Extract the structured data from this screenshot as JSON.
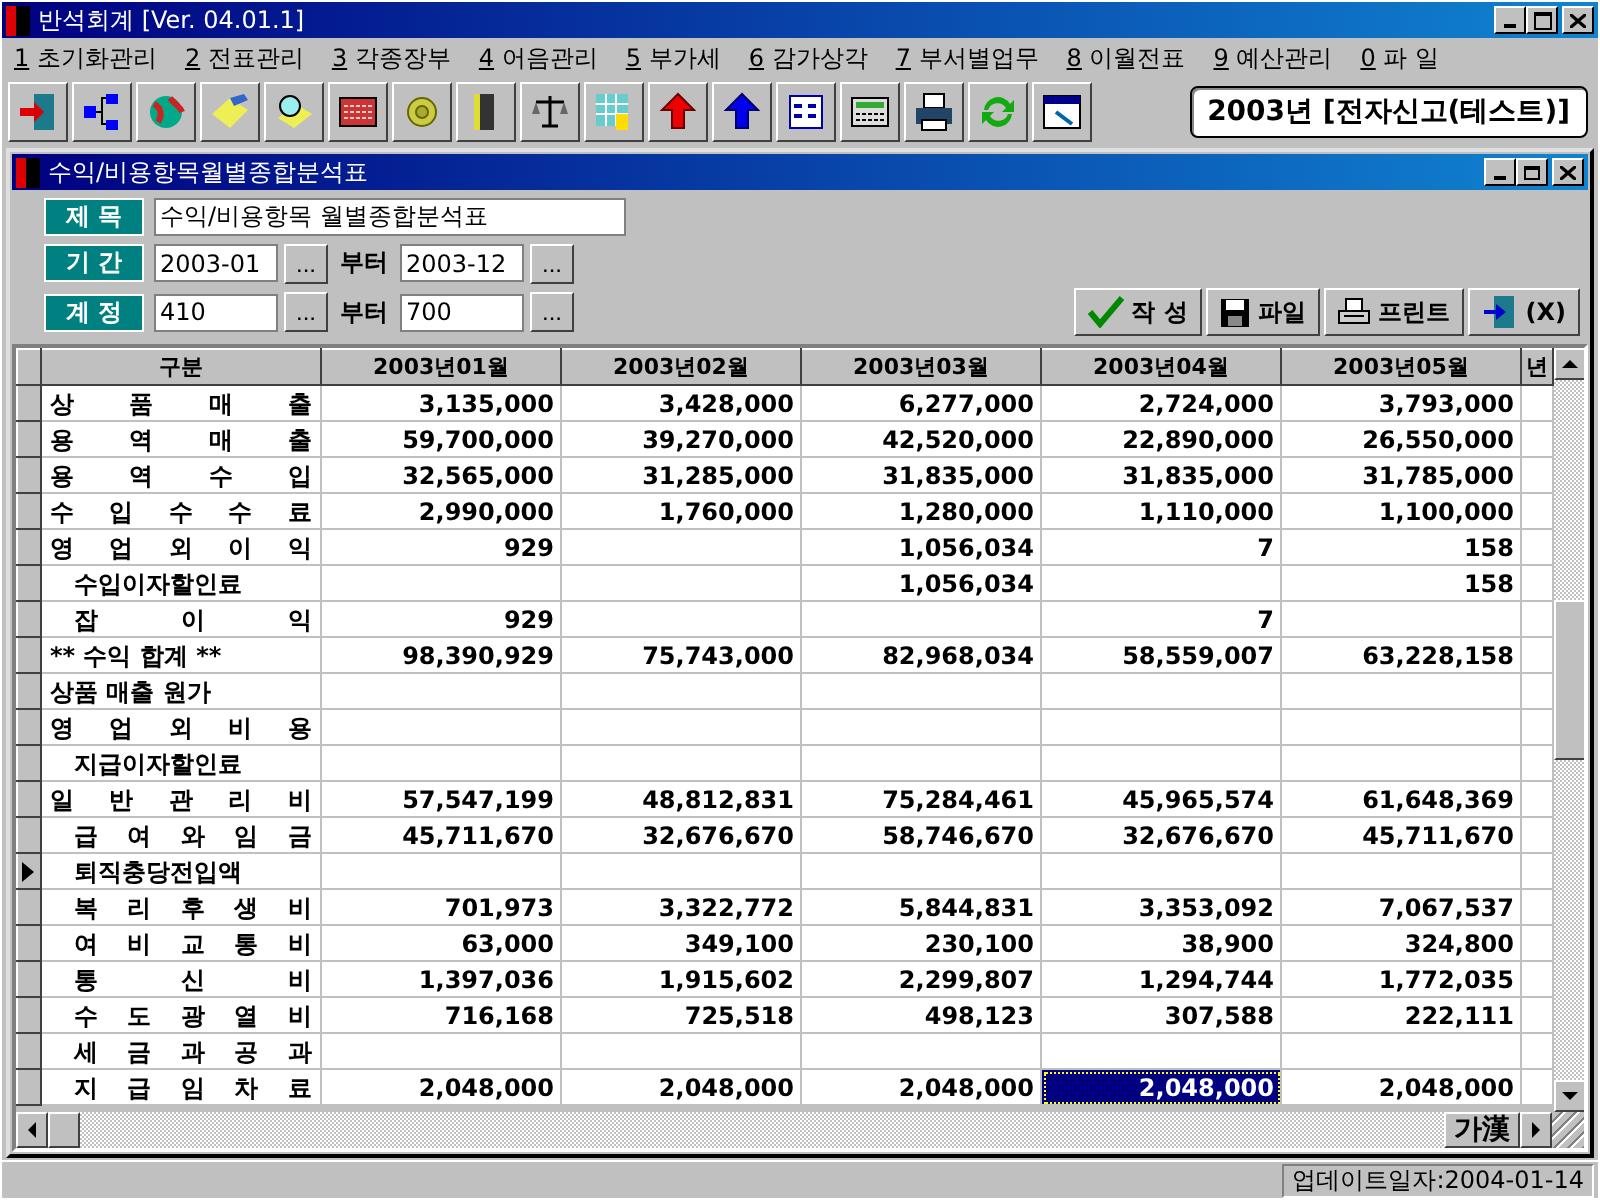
{
  "window": {
    "title": "반석회계 [Ver. 04.01.1]"
  },
  "menu": [
    {
      "key": "1",
      "label": "초기화관리"
    },
    {
      "key": "2",
      "label": "전표관리"
    },
    {
      "key": "3",
      "label": "각종장부"
    },
    {
      "key": "4",
      "label": "어음관리"
    },
    {
      "key": "5",
      "label": "부가세"
    },
    {
      "key": "6",
      "label": "감가상각"
    },
    {
      "key": "7",
      "label": "부서별업무"
    },
    {
      "key": "8",
      "label": "이월전표"
    },
    {
      "key": "9",
      "label": "예산관리"
    },
    {
      "key": "0",
      "label": "파 일"
    }
  ],
  "company_badge": "2003년 [전자신고(테스트)]",
  "child_window": {
    "title": "수익/비용항목월별종합분석표"
  },
  "form": {
    "title_label": "제 목",
    "title_value": "수익/비용항목 월별종합분석표",
    "period_label": "기 간",
    "period_from": "2003-01",
    "period_to": "2003-12",
    "account_label": "계 정",
    "account_from": "410",
    "account_to": "700",
    "from_word": [
      "부터",
      "부터"
    ],
    "browse": [
      "...",
      "...",
      "...",
      "..."
    ]
  },
  "actions": [
    {
      "kind": "check",
      "label": "작 성"
    },
    {
      "kind": "disk",
      "label": "파일"
    },
    {
      "kind": "printer",
      "label": "프린트"
    },
    {
      "kind": "exit",
      "label": "(X)"
    }
  ],
  "table": {
    "label_header": "구분",
    "columns": [
      "2003년01월",
      "2003년02월",
      "2003년03월",
      "2003년04월",
      "2003년05월",
      "년"
    ],
    "rows": [
      {
        "label": "상 품 매 출",
        "kind": "main",
        "current": false,
        "cells": [
          {
            "v": "3,135,000",
            "selected": false
          },
          {
            "v": "3,428,000",
            "selected": false
          },
          {
            "v": "6,277,000",
            "selected": false
          },
          {
            "v": "2,724,000",
            "selected": false
          },
          {
            "v": "3,793,000",
            "selected": false
          }
        ]
      },
      {
        "label": "용 역 매 출",
        "kind": "main",
        "current": false,
        "cells": [
          {
            "v": "59,700,000",
            "selected": false
          },
          {
            "v": "39,270,000",
            "selected": false
          },
          {
            "v": "42,520,000",
            "selected": false
          },
          {
            "v": "22,890,000",
            "selected": false
          },
          {
            "v": "26,550,000",
            "selected": false
          }
        ]
      },
      {
        "label": "용 역 수 입",
        "kind": "main",
        "current": false,
        "cells": [
          {
            "v": "32,565,000",
            "selected": false
          },
          {
            "v": "31,285,000",
            "selected": false
          },
          {
            "v": "31,835,000",
            "selected": false
          },
          {
            "v": "31,835,000",
            "selected": false
          },
          {
            "v": "31,785,000",
            "selected": false
          }
        ]
      },
      {
        "label": "수 입 수 수 료",
        "kind": "main",
        "current": false,
        "cells": [
          {
            "v": "2,990,000",
            "selected": false
          },
          {
            "v": "1,760,000",
            "selected": false
          },
          {
            "v": "1,280,000",
            "selected": false
          },
          {
            "v": "1,110,000",
            "selected": false
          },
          {
            "v": "1,100,000",
            "selected": false
          }
        ]
      },
      {
        "label": "영 업 외 이 익",
        "kind": "main",
        "current": false,
        "cells": [
          {
            "v": "929",
            "selected": false
          },
          {
            "selected": false
          },
          {
            "v": "1,056,034",
            "selected": false
          },
          {
            "v": "7",
            "selected": false
          },
          {
            "v": "158",
            "selected": false
          }
        ]
      },
      {
        "label": "수입이자할인료",
        "kind": "sub-plain",
        "current": false,
        "cells": [
          {
            "selected": false
          },
          {
            "selected": false
          },
          {
            "v": "1,056,034",
            "selected": false
          },
          {
            "selected": false
          },
          {
            "v": "158",
            "selected": false
          }
        ]
      },
      {
        "label": "잡 이 익",
        "kind": "sub",
        "current": false,
        "cells": [
          {
            "v": "929",
            "selected": false
          },
          {
            "selected": false
          },
          {
            "selected": false
          },
          {
            "v": "7",
            "selected": false
          },
          {
            "selected": false
          }
        ]
      },
      {
        "label": "** 수익 합계 **",
        "kind": "plain",
        "current": false,
        "cells": [
          {
            "v": "98,390,929",
            "selected": false
          },
          {
            "v": "75,743,000",
            "selected": false
          },
          {
            "v": "82,968,034",
            "selected": false
          },
          {
            "v": "58,559,007",
            "selected": false
          },
          {
            "v": "63,228,158",
            "selected": false
          }
        ]
      },
      {
        "label": "상품 매출 원가",
        "kind": "plain",
        "current": false,
        "cells": [
          {
            "selected": false
          },
          {
            "selected": false
          },
          {
            "selected": false
          },
          {
            "selected": false
          },
          {
            "selected": false
          }
        ]
      },
      {
        "label": "영 업 외 비 용",
        "kind": "main",
        "current": false,
        "cells": [
          {
            "selected": false
          },
          {
            "selected": false
          },
          {
            "selected": false
          },
          {
            "selected": false
          },
          {
            "selected": false
          }
        ]
      },
      {
        "label": "지급이자할인료",
        "kind": "sub-plain",
        "current": false,
        "cells": [
          {
            "selected": false
          },
          {
            "selected": false
          },
          {
            "selected": false
          },
          {
            "selected": false
          },
          {
            "selected": false
          }
        ]
      },
      {
        "label": "일 반 관 리 비",
        "kind": "main",
        "current": false,
        "cells": [
          {
            "v": "57,547,199",
            "selected": false
          },
          {
            "v": "48,812,831",
            "selected": false
          },
          {
            "v": "75,284,461",
            "selected": false
          },
          {
            "v": "45,965,574",
            "selected": false
          },
          {
            "v": "61,648,369",
            "selected": false
          }
        ]
      },
      {
        "label": "급 여 와 임 금",
        "kind": "sub",
        "current": false,
        "cells": [
          {
            "v": "45,711,670",
            "selected": false
          },
          {
            "v": "32,676,670",
            "selected": false
          },
          {
            "v": "58,746,670",
            "selected": false
          },
          {
            "v": "32,676,670",
            "selected": false
          },
          {
            "v": "45,711,670",
            "selected": false
          }
        ]
      },
      {
        "label": "퇴직충당전입액",
        "kind": "sub-plain",
        "current": true,
        "cells": [
          {
            "selected": false
          },
          {
            "selected": false
          },
          {
            "selected": false
          },
          {
            "selected": false
          },
          {
            "selected": false
          }
        ]
      },
      {
        "label": "복 리 후 생 비",
        "kind": "sub",
        "current": false,
        "cells": [
          {
            "v": "701,973",
            "selected": false
          },
          {
            "v": "3,322,772",
            "selected": false
          },
          {
            "v": "5,844,831",
            "selected": false
          },
          {
            "v": "3,353,092",
            "selected": false
          },
          {
            "v": "7,067,537",
            "selected": false
          }
        ]
      },
      {
        "label": "여 비 교 통 비",
        "kind": "sub",
        "current": false,
        "cells": [
          {
            "v": "63,000",
            "selected": false
          },
          {
            "v": "349,100",
            "selected": false
          },
          {
            "v": "230,100",
            "selected": false
          },
          {
            "v": "38,900",
            "selected": false
          },
          {
            "v": "324,800",
            "selected": false
          }
        ]
      },
      {
        "label": "통 신 비",
        "kind": "sub",
        "current": false,
        "cells": [
          {
            "v": "1,397,036",
            "selected": false
          },
          {
            "v": "1,915,602",
            "selected": false
          },
          {
            "v": "2,299,807",
            "selected": false
          },
          {
            "v": "1,294,744",
            "selected": false
          },
          {
            "v": "1,772,035",
            "selected": false
          }
        ]
      },
      {
        "label": "수 도 광 열 비",
        "kind": "sub",
        "current": false,
        "cells": [
          {
            "v": "716,168",
            "selected": false
          },
          {
            "v": "725,518",
            "selected": false
          },
          {
            "v": "498,123",
            "selected": false
          },
          {
            "v": "307,588",
            "selected": false
          },
          {
            "v": "222,111",
            "selected": false
          }
        ]
      },
      {
        "label": "세 금 과 공 과",
        "kind": "sub",
        "current": false,
        "cells": [
          {
            "selected": false
          },
          {
            "selected": false
          },
          {
            "selected": false
          },
          {
            "selected": false
          },
          {
            "selected": false
          }
        ]
      },
      {
        "label": "지 급 임 차 료",
        "kind": "sub",
        "current": false,
        "cells": [
          {
            "v": "2,048,000",
            "selected": false
          },
          {
            "v": "2,048,000",
            "selected": false
          },
          {
            "v": "2,048,000",
            "selected": false
          },
          {
            "v": "2,048,000",
            "selected": true
          },
          {
            "v": "2,048,000",
            "selected": false
          }
        ]
      }
    ]
  },
  "ime_indicator": "가漢",
  "status_bar": "업데이트일자:2004-01-14"
}
